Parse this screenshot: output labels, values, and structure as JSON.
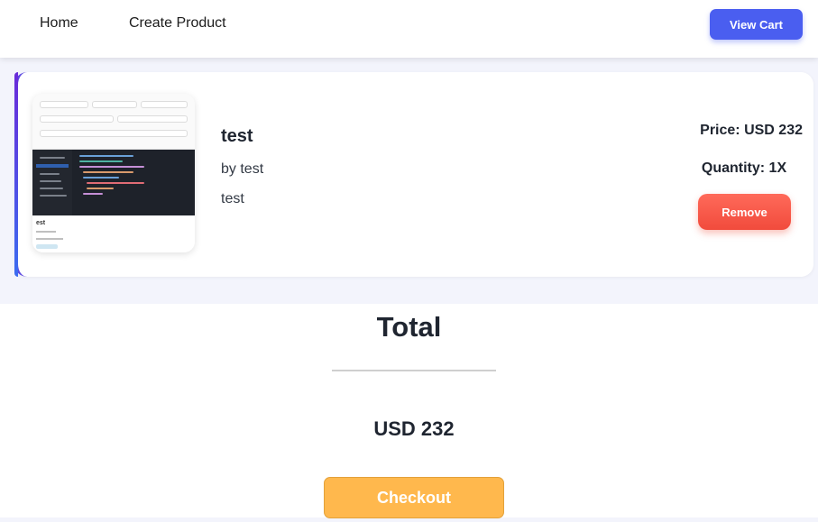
{
  "nav": {
    "home_label": "Home",
    "create_label": "Create Product",
    "view_cart_label": "View Cart"
  },
  "cart": {
    "items": [
      {
        "title": "test",
        "author": "by test",
        "description": "test",
        "price": "Price: USD 232",
        "quantity": "Quantity: 1X",
        "remove_label": "Remove",
        "thumbnail": {
          "caption": "est"
        }
      }
    ]
  },
  "summary": {
    "heading": "Total",
    "amount": "USD 232",
    "checkout_label": "Checkout"
  },
  "colors": {
    "primary": "#4a5ef0",
    "danger": "#f14b3c",
    "checkout": "#ffb84d",
    "accent_gradient_start": "#6a2bd9",
    "accent_gradient_end": "#3b6cf0"
  }
}
